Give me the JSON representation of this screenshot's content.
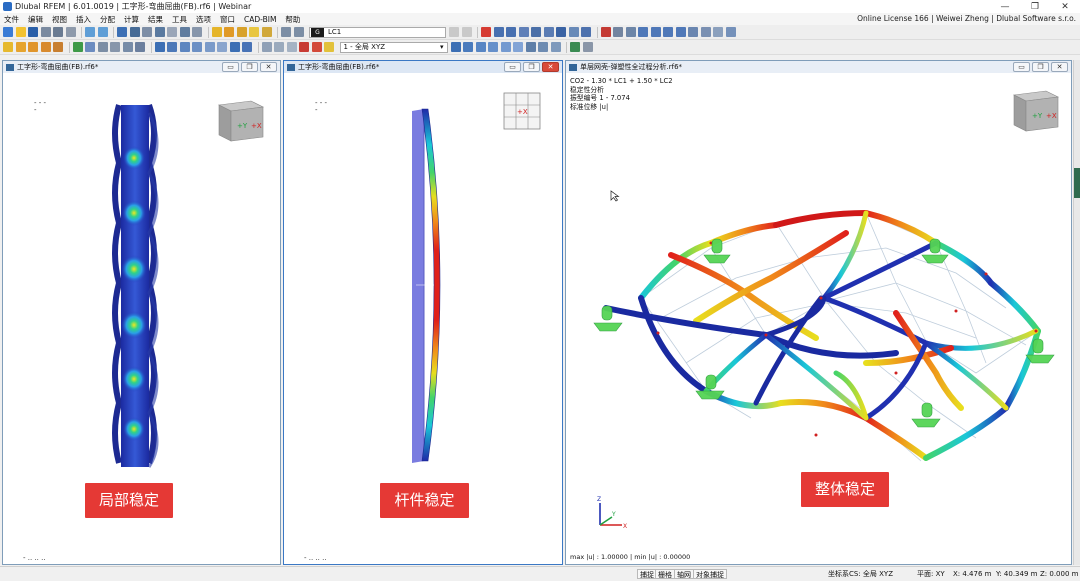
{
  "window": {
    "title": "Dlubal RFEM | 6.01.0019 | 工字形-弯曲屈曲(FB).rf6 | Webinar",
    "license": "Online License 166 | Weiwei Zheng | Dlubal Software s.r.o.",
    "controls": {
      "minimize": "—",
      "restore": "❐",
      "close": "✕"
    }
  },
  "menu": [
    "文件",
    "编辑",
    "视图",
    "插入",
    "分配",
    "计算",
    "结果",
    "工具",
    "选项",
    "窗口",
    "CAD-BIM",
    "帮助"
  ],
  "toolbar": {
    "load_case_code": "G",
    "load_case": "LC1",
    "view_combo": "1 - 全局 XYZ",
    "combo_arrow": "▾"
  },
  "panels": [
    {
      "title": "工字形-弯曲屈曲(FB).rf6*",
      "cube_labels": [
        "+Y",
        "+X"
      ],
      "dots_top": "- - -",
      "dots_top2": "-",
      "dots_bottom": "-  ..  ..  ..",
      "label": "局部稳定"
    },
    {
      "title": "工字形-弯曲屈曲(FB).rf6*",
      "cube_labels": [
        "+X"
      ],
      "dots_top": "- - -",
      "dots_top2": "-",
      "dots_bottom": "-  ..  ..  ..",
      "label": "杆件稳定"
    },
    {
      "title": "单层网壳-弹塑性全过程分析.rf6*",
      "info": [
        "CO2 - 1.30 * LC1 + 1.50 * LC2",
        "稳定性分析",
        "振型编号 1 - 7.074",
        "标准位移 |u|"
      ],
      "cube_labels": [
        "+Y",
        "+X"
      ],
      "axis": {
        "x": "X",
        "y": "Y",
        "z": "Z"
      },
      "status": "max |u| : 1.00000 | min |u| : 0.00000",
      "label": "整体稳定"
    }
  ],
  "panel_buttons": {
    "minimize": "▭",
    "restore": "❐",
    "close": "✕"
  },
  "statusbar": {
    "buttons": [
      "捕捉",
      "栅格",
      "轴网",
      "对象捕捉"
    ],
    "cs": "坐标系CS: 全局 XYZ",
    "plane": "平面: XY",
    "x": "X: 4.476 m",
    "y": "Y: 40.349 m",
    "z": "Z: 0.000 m"
  },
  "colors": {
    "label_red": "#e53935",
    "deep_blue": "#1f2aa8",
    "mid_blue": "#2e5fd8",
    "cyan": "#19c7d8",
    "green": "#43d46a",
    "yellow": "#e8de1e",
    "orange": "#f08a1a",
    "red": "#e0201b",
    "support_green": "#55d455"
  }
}
